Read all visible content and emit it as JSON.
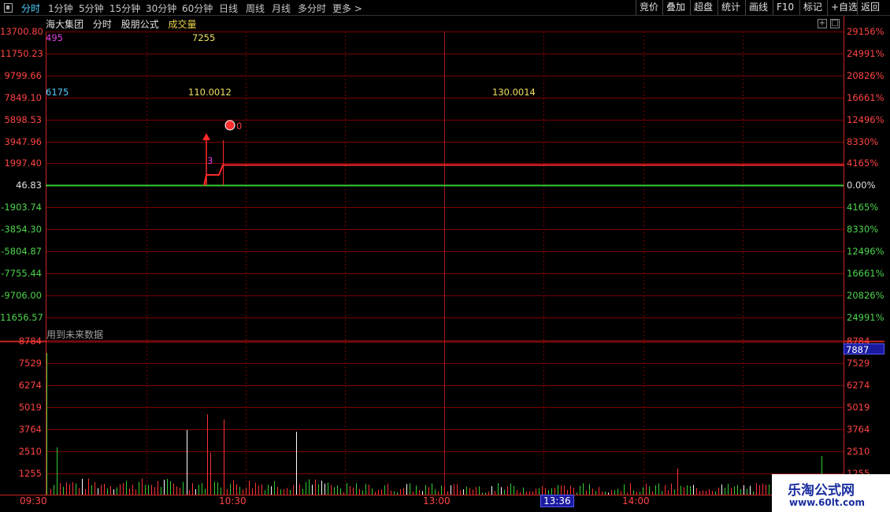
{
  "toolbar": {
    "periods": [
      "分时",
      "1分钟",
      "5分钟",
      "15分钟",
      "30分钟",
      "60分钟",
      "日线",
      "周线",
      "月线",
      "多分时",
      "更多 >"
    ],
    "right_buttons": [
      "竞价",
      "叠加",
      "超盘",
      "统计",
      "画线",
      "F10",
      "标记",
      "+自选",
      "返回"
    ]
  },
  "header": {
    "stock_name": "海大集团",
    "mode": "分时",
    "formula": "股朋公式",
    "indicator": "成交量"
  },
  "price_panel": {
    "left_labels": [
      "13700.80",
      "11750.23",
      "9799.66",
      "7849.10",
      "5898.53",
      "3947.96",
      "1997.40",
      "46.83",
      "-1903.74",
      "-3854.30",
      "-5804.87",
      "-7755.44",
      "-9706.00",
      "11656.57"
    ],
    "right_labels": [
      "29156%",
      "24991%",
      "20826%",
      "16661%",
      "12496%",
      "8330%",
      "4165%",
      "0.00%",
      "4165%",
      "8330%",
      "12496%",
      "16661%",
      "20826%",
      "24991%"
    ],
    "overlays": {
      "v1": "495",
      "v2": "7255",
      "v3": "6175",
      "v4": "110.0012",
      "v5": "130.0014",
      "marker_num": "3",
      "marker_zero": "0"
    },
    "future_data_note": "用到未来数据"
  },
  "volume_panel": {
    "left_labels": [
      "8784",
      "7529",
      "6274",
      "5019",
      "3764",
      "2510",
      "1255"
    ],
    "right_labels": [
      "8784",
      "7529",
      "6274",
      "5019",
      "3764",
      "2510",
      "1255"
    ],
    "cursor_value": "7887",
    "max": 8784
  },
  "time_axis": {
    "labels": [
      "09:30",
      "10:30",
      "13:00",
      "14:00"
    ],
    "cursor_time": "13:36"
  },
  "watermark": {
    "line1": "乐淘公式网",
    "line2": "www.60lt.com"
  },
  "colors": {
    "grid": "#7a0000",
    "price_line": "#ff2a2a",
    "baseline": "#33cc33",
    "up": "#ff3333",
    "down": "#33cc33",
    "neutral": "#ffffff"
  }
}
